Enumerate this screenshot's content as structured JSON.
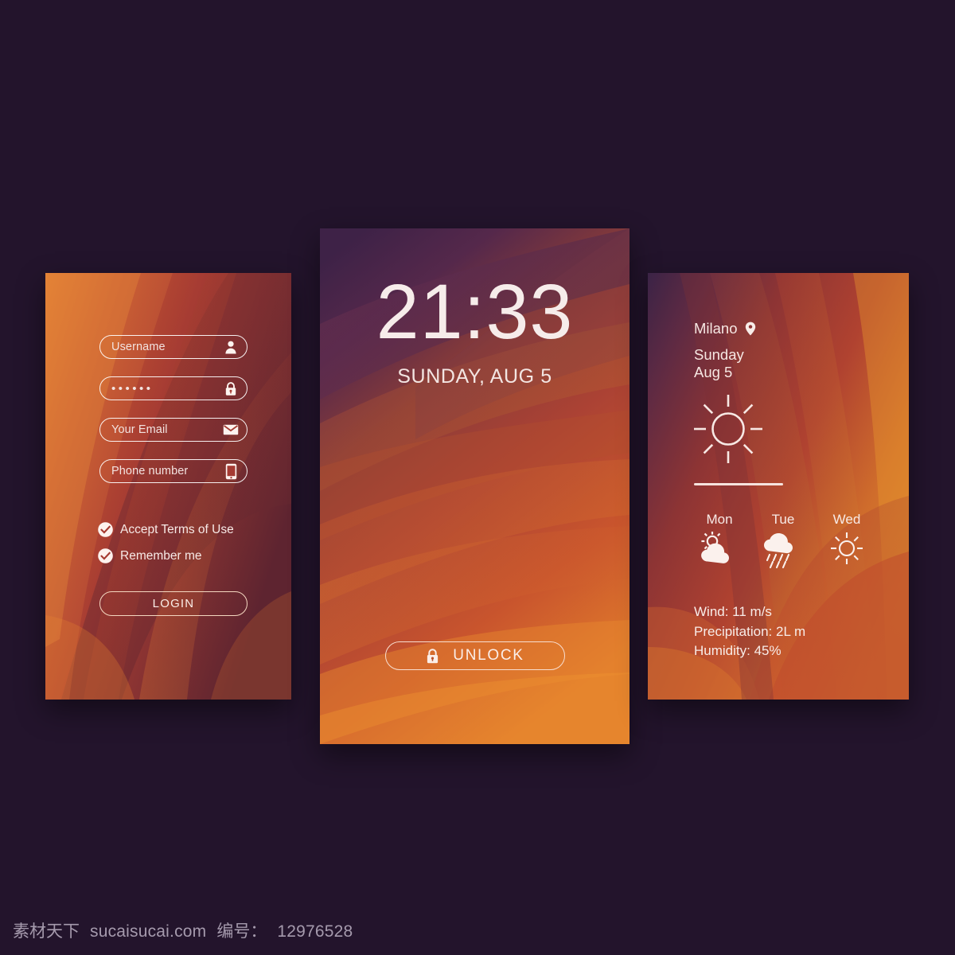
{
  "background_color": "#23142c",
  "login": {
    "panel_name": "login-screen",
    "fields": [
      {
        "name": "username",
        "value": "Username",
        "icon": "user-icon"
      },
      {
        "name": "password",
        "value": "••••••",
        "icon": "lock-icon"
      },
      {
        "name": "email",
        "value": "Your Email",
        "icon": "envelope-icon"
      },
      {
        "name": "phone",
        "value": "Phone number",
        "icon": "phone-icon"
      }
    ],
    "checkboxes": [
      {
        "label": "Accept Terms of Use",
        "checked": true
      },
      {
        "label": "Remember me",
        "checked": true
      }
    ],
    "login_button": "LOGIN"
  },
  "lockscreen": {
    "panel_name": "lock-screen",
    "time": "21:33",
    "date": "SUNDAY, AUG 5",
    "unlock_button": "UNLOCK",
    "unlock_icon": "lock-icon"
  },
  "weather": {
    "panel_name": "weather-screen",
    "city": "Milano",
    "location_icon": "map-pin-icon",
    "day": "Sunday",
    "date": "Aug 5",
    "current_icon": "sun-icon",
    "forecast": [
      {
        "day": "Mon",
        "icon": "sun-cloud-icon"
      },
      {
        "day": "Tue",
        "icon": "rain-cloud-icon"
      },
      {
        "day": "Wed",
        "icon": "sun-icon"
      }
    ],
    "stats": [
      "Wind: 11 m/s",
      "Precipitation: 2L m",
      "Humidity: 45%"
    ]
  },
  "footer": {
    "site_cn": "素材天下",
    "site_url": "sucaisucai.com",
    "id_label": "编号：",
    "id_value": "12976528"
  }
}
